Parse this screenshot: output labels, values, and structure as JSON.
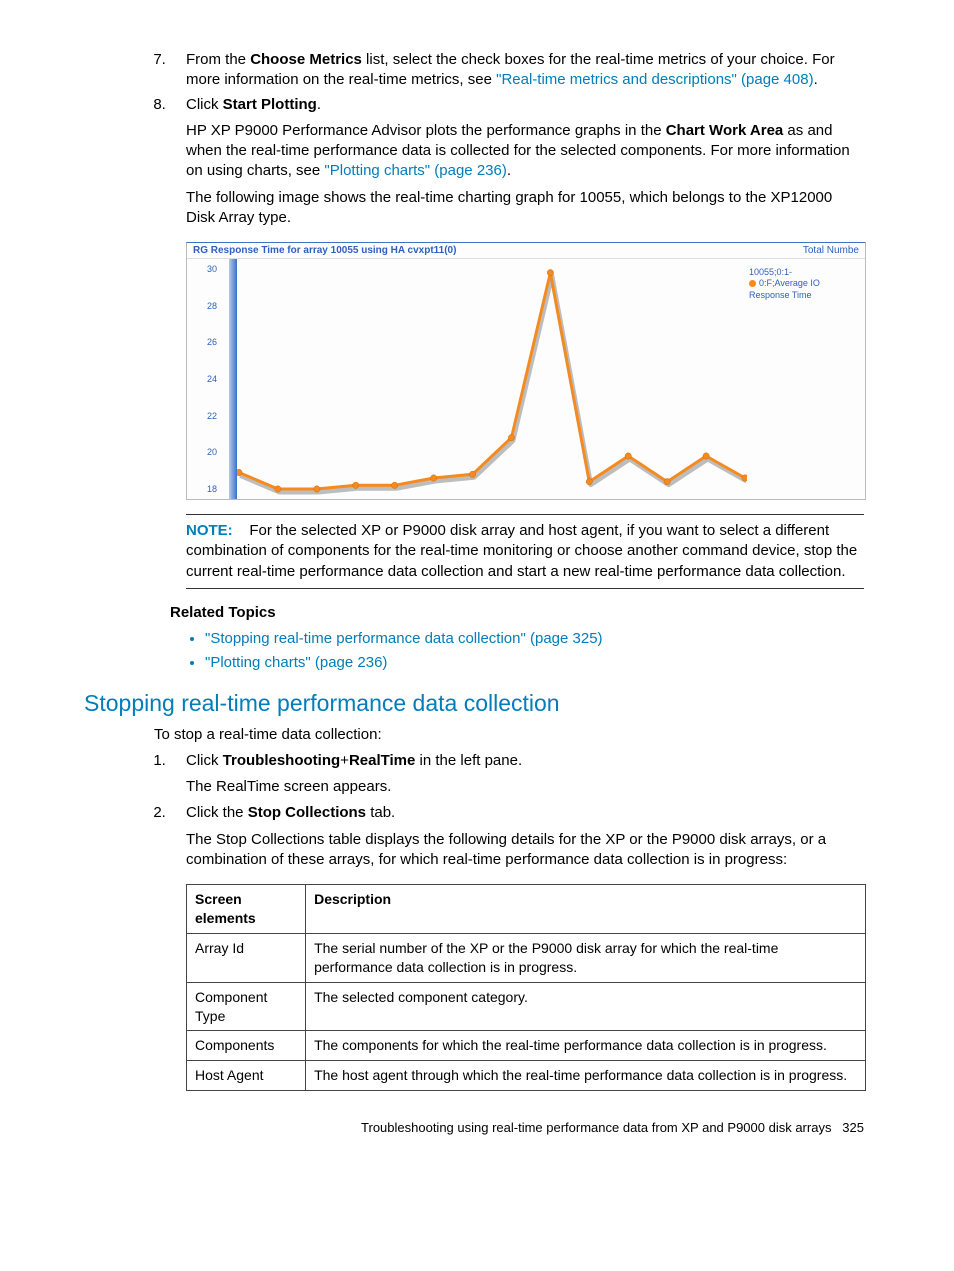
{
  "step7": {
    "line1_a": "From the ",
    "line1_b": "Choose Metrics",
    "line1_c": " list, select the check boxes for the real-time metrics of your choice. For more information on the real-time metrics, see ",
    "link1": "\"Real-time metrics and descriptions\" (page 408)",
    "line1_d": "."
  },
  "step8": {
    "line1_a": "Click ",
    "line1_b": "Start Plotting",
    "line1_c": ".",
    "para2_a": "HP XP P9000 Performance Advisor plots the performance graphs in the ",
    "para2_b": "Chart Work Area",
    "para2_c": " as and when the real-time performance data is collected for the selected components. For more information on using charts, see ",
    "link2": "\"Plotting charts\" (page 236)",
    "para2_d": ".",
    "para3": "The following image shows the real-time charting graph for 10055, which belongs to the XP12000 Disk Array type."
  },
  "chart_data": {
    "type": "line",
    "title": "RG Response Time for array 10055 using HA cvxpt11(0)",
    "right_title": "Total Numbe",
    "ylabel": "",
    "xlabel": "",
    "ylim": [
      18,
      30
    ],
    "yticks": [
      30,
      28,
      26,
      24,
      22,
      20,
      18
    ],
    "x": [
      0,
      1,
      2,
      3,
      4,
      5,
      6,
      7,
      8,
      9,
      10,
      11,
      12,
      13
    ],
    "values": [
      18.9,
      18.0,
      18.0,
      18.2,
      18.2,
      18.6,
      18.8,
      20.8,
      29.8,
      18.4,
      19.8,
      18.4,
      19.8,
      18.6
    ],
    "legend": {
      "line1": "10055;0:1-",
      "line2": "0:F;Average IO",
      "line3": "Response Time"
    }
  },
  "note": {
    "label": "NOTE:",
    "text": "For the selected XP or P9000 disk array and host agent, if you want to select a different combination of components for the real-time monitoring or choose another command device, stop the current real-time performance data collection and start a new real-time performance data collection."
  },
  "related": {
    "heading": "Related Topics",
    "items": [
      "\"Stopping real-time performance data collection\" (page 325)",
      "\"Plotting charts\" (page 236)"
    ]
  },
  "section2": {
    "heading": "Stopping real-time performance data collection",
    "intro": "To stop a real-time data collection:",
    "step1_a": "Click ",
    "step1_b": "Troubleshooting",
    "step1_c": "+",
    "step1_d": "RealTime",
    "step1_e": " in the left pane.",
    "step1_p": "The RealTime screen appears.",
    "step2_a": "Click the ",
    "step2_b": "Stop Collections",
    "step2_c": " tab.",
    "step2_p": "The Stop Collections table displays the following details for the XP or the P9000 disk arrays, or a combination of these arrays, for which real-time performance data collection is in progress:"
  },
  "table": {
    "headers": [
      "Screen elements",
      "Description"
    ],
    "rows": [
      [
        "Array Id",
        "The serial number of the XP or the P9000 disk array for which the real-time performance data collection is in progress."
      ],
      [
        "Component Type",
        "The selected component category."
      ],
      [
        "Components",
        "The components for which the real-time performance data collection is in progress."
      ],
      [
        "Host Agent",
        "The host agent through which the real-time performance data collection is in progress."
      ]
    ]
  },
  "footer": {
    "text": "Troubleshooting using real-time performance data from XP and P9000 disk arrays",
    "page": "325"
  }
}
